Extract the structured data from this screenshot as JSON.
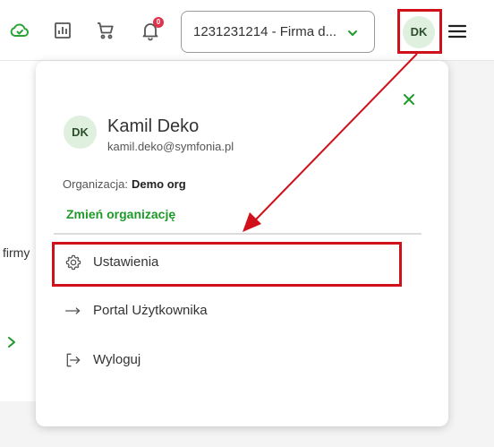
{
  "topbar": {
    "notification_count": "0",
    "company_select": {
      "value": "1231231214 - Firma d..."
    },
    "avatar_initials": "DK"
  },
  "background": {
    "partial_text": "firmy"
  },
  "user_menu": {
    "avatar_initials": "DK",
    "name": "Kamil Deko",
    "email": "kamil.deko@symfonia.pl",
    "organization_label": "Organizacja:",
    "organization_name": "Demo org",
    "change_org_label": "Zmień organizację",
    "items": [
      {
        "label": "Ustawienia",
        "icon": "gear-icon"
      },
      {
        "label": "Portal Użytkownika",
        "icon": "arrow-right-icon"
      },
      {
        "label": "Wyloguj",
        "icon": "logout-icon"
      }
    ]
  },
  "colors": {
    "accent_green": "#1f9a2a",
    "highlight_red": "#d0101b",
    "badge_red": "#e0344a",
    "avatar_bg": "#dff0df"
  }
}
